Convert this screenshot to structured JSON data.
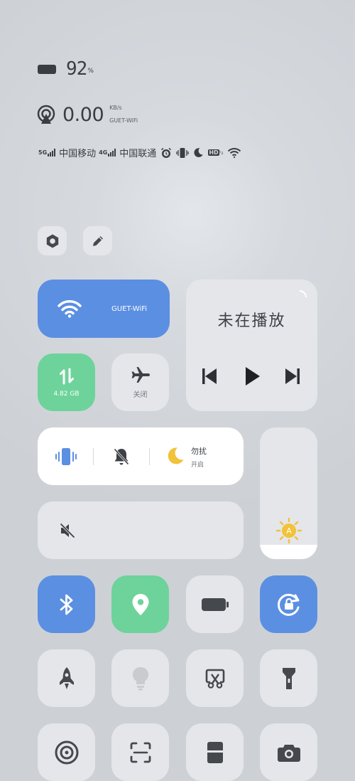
{
  "status": {
    "battery_percent": "92",
    "battery_unit": "%",
    "network_speed": "0.00",
    "speed_unit": "KB/s",
    "wifi_name_small": "GUET-WiFi",
    "sim1_type": "5G",
    "sim1_carrier": "中国移动",
    "sim2_type": "4G",
    "sim2_carrier": "中国联通",
    "hd_label": "HD"
  },
  "tiles": {
    "wifi": {
      "label": "GUET-WiFi",
      "active": true
    },
    "media": {
      "status": "未在播放"
    },
    "mobile_data": {
      "label": "4.82 GB",
      "active": true
    },
    "airplane": {
      "label": "关闭",
      "active": false
    },
    "sound": {
      "dnd_label": "勿扰",
      "dnd_status": "开启"
    },
    "brightness": {
      "level": 0.11,
      "mode": "auto"
    }
  },
  "icons": [
    "settings-icon",
    "edit-icon",
    "wifi-icon",
    "mobile-data-icon",
    "airplane-icon",
    "vibrate-icon",
    "mute-bell-icon",
    "moon-icon",
    "mute-speaker-icon",
    "sun-auto-icon",
    "bluetooth-icon",
    "location-icon",
    "battery-saver-icon",
    "rotation-lock-icon",
    "rocket-icon",
    "bulb-icon",
    "screenshot-icon",
    "flashlight-icon",
    "hotspot-icon",
    "scan-icon",
    "card-icon",
    "camera-icon"
  ],
  "colors": {
    "accent_blue": "#5b8fe2",
    "accent_green": "#6dd39a",
    "moon_yellow": "#f2c23a",
    "tile_bg": "#e4e6ea"
  }
}
